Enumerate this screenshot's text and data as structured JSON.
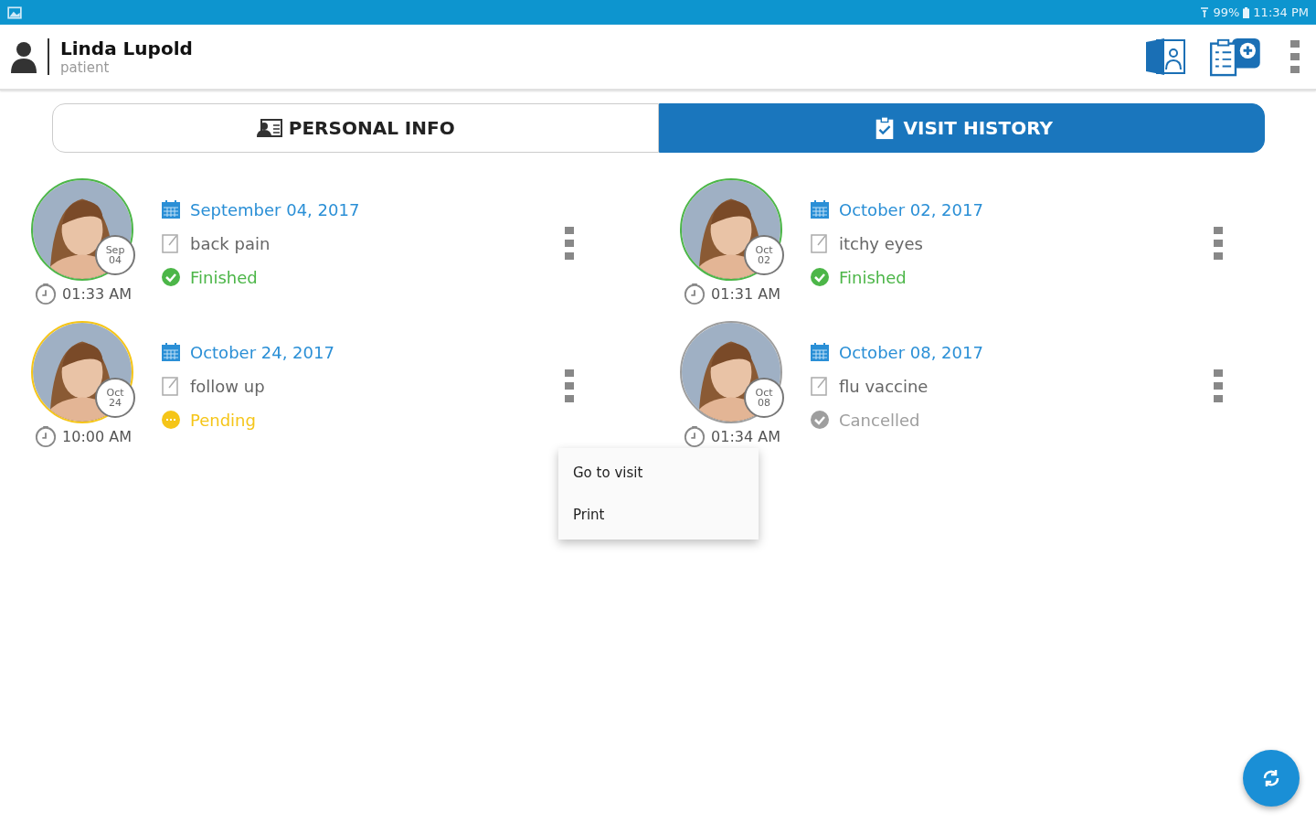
{
  "status_bar": {
    "battery": "99%",
    "time": "11:34 PM"
  },
  "header": {
    "name": "Linda Lupold",
    "role": "patient"
  },
  "tabs": [
    {
      "label": "PERSONAL INFO",
      "selected": false,
      "kind": "info"
    },
    {
      "label": "VISIT HISTORY",
      "selected": true,
      "kind": "history"
    }
  ],
  "visits": [
    {
      "badge_month": "Sep",
      "badge_day": "04",
      "time": "01:33 AM",
      "date": "September 04, 2017",
      "reason": "back pain",
      "status": "Finished",
      "kind": "finished"
    },
    {
      "badge_month": "Oct",
      "badge_day": "02",
      "time": "01:31 AM",
      "date": "October 02, 2017",
      "reason": "itchy eyes",
      "status": "Finished",
      "kind": "finished"
    },
    {
      "badge_month": "Oct",
      "badge_day": "24",
      "time": "10:00 AM",
      "date": "October 24, 2017",
      "reason": "follow up",
      "status": "Pending",
      "kind": "pending"
    },
    {
      "badge_month": "Oct",
      "badge_day": "08",
      "time": "01:34 AM",
      "date": "October 08, 2017",
      "reason": "flu vaccine",
      "status": "Cancelled",
      "kind": "cancelled"
    }
  ],
  "context_menu": {
    "items": [
      "Go to visit",
      "Print"
    ]
  }
}
